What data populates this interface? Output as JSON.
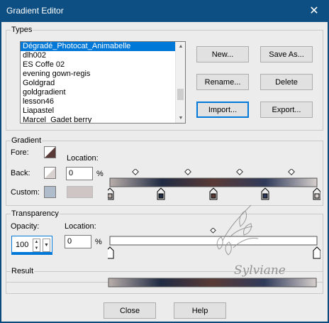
{
  "window": {
    "title": "Gradient Editor",
    "close_glyph": "✕"
  },
  "types": {
    "label": "Types",
    "list_items": [
      "Dégradé_Photocat_Animabelle",
      "dlh002",
      "ES Coffe 02",
      "evening gown-regis",
      "Goldgrad",
      "goldgradient",
      "lesson46",
      "Liapastel",
      "Marcel_Gadet berry"
    ],
    "selected_index": 0,
    "buttons": {
      "new": "New...",
      "save_as": "Save As...",
      "rename": "Rename...",
      "delete": "Delete",
      "import": "Import...",
      "export": "Export..."
    }
  },
  "gradient": {
    "label": "Gradient",
    "fore_label": "Fore:",
    "back_label": "Back:",
    "custom_label": "Custom:",
    "location_label": "Location:",
    "location_value": "0",
    "percent": "%",
    "fore_color": "#5a3a36",
    "back_color": "#d8cfcf",
    "custom_color": "#aebccc",
    "custom_preview_color": "#cfc5c4",
    "stops": [
      "#b9aeaa",
      "#202b44",
      "#5a3a36",
      "#2f3a5a",
      "#d6cfcd"
    ]
  },
  "transparency": {
    "label": "Transparency",
    "opacity_label": "Opacity:",
    "opacity_value": "100",
    "location_label": "Location:",
    "location_value": "0",
    "percent": "%"
  },
  "result": {
    "label": "Result"
  },
  "footer": {
    "close": "Close",
    "help": "Help"
  },
  "watermark": {
    "text": "Sylviane"
  }
}
